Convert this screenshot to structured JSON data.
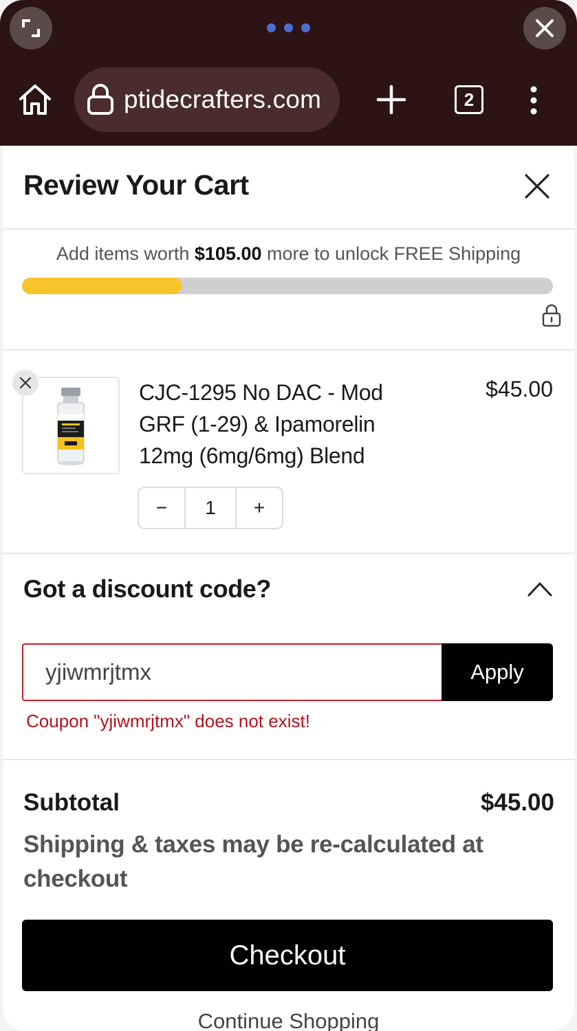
{
  "browser": {
    "url": "ptidecrafters.com",
    "tab_count": "2",
    "icons": [
      "expand-icon",
      "close-icon",
      "home-icon",
      "lock-icon",
      "new-tab-icon",
      "tabs-icon",
      "menu-icon"
    ]
  },
  "cart": {
    "title": "Review Your Cart",
    "shipping": {
      "prefix": "Add items worth ",
      "amount": "$105.00",
      "suffix": " more to unlock FREE Shipping",
      "progress_percent": 30
    },
    "item": {
      "name": "CJC-1295 No DAC - Mod GRF (1-29) & Ipamorelin 12mg (6mg/6mg) Blend",
      "price": "$45.00",
      "quantity": "1",
      "minus": "−",
      "plus": "+"
    },
    "discount": {
      "title": "Got a discount code?",
      "input_value": "yjiwmrjtmx",
      "apply_label": "Apply",
      "error": "Coupon \"yjiwmrjtmx\" does not exist!"
    },
    "summary": {
      "subtotal_label": "Subtotal",
      "subtotal_value": "$45.00",
      "note": "Shipping & taxes may be re-calculated at checkout"
    },
    "checkout_label": "Checkout",
    "continue_label": "Continue Shopping"
  },
  "colors": {
    "chrome_bg": "#2c1414",
    "progress_fill": "#f7c52a",
    "error": "#b5121b",
    "button_bg": "#000000"
  }
}
